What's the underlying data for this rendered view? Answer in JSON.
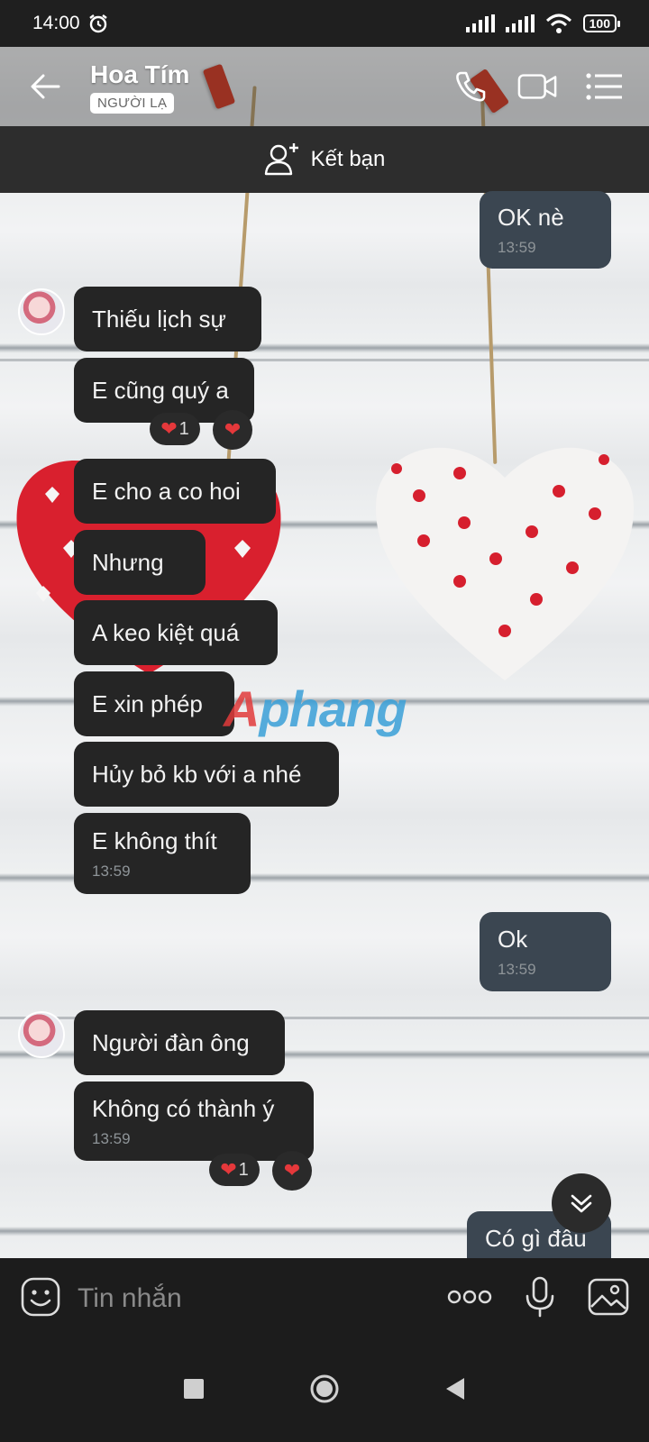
{
  "status_bar": {
    "time": "14:00",
    "battery": "100",
    "icons": [
      "alarm-icon",
      "signal-icon",
      "signal-icon",
      "wifi-icon",
      "battery-icon"
    ]
  },
  "header": {
    "contact_name": "Hoa Tím",
    "badge": "NGƯỜI LẠ",
    "icons": [
      "back-arrow-icon",
      "phone-icon",
      "video-call-icon",
      "menu-list-icon"
    ]
  },
  "add_friend": {
    "label": "Kết bạn",
    "icon": "add-user-icon"
  },
  "messages": [
    {
      "side": "sent",
      "text": "OK nè",
      "time": "13:59"
    },
    {
      "side": "received",
      "text": "Thiếu lịch sự"
    },
    {
      "side": "received",
      "text": "E cũng quý a",
      "reaction": {
        "emoji": "heart",
        "count": "1"
      }
    },
    {
      "side": "received",
      "text": "E cho a co hoi"
    },
    {
      "side": "received",
      "text": "Nhưng"
    },
    {
      "side": "received",
      "text": "A keo kiệt quá"
    },
    {
      "side": "received",
      "text": "E xin phép"
    },
    {
      "side": "received",
      "text": "Hủy bỏ kb với a nhé"
    },
    {
      "side": "received",
      "text": "E không thít",
      "time": "13:59"
    },
    {
      "side": "sent",
      "text": "Ok",
      "time": "13:59"
    },
    {
      "side": "received",
      "text": "Người đàn ông"
    },
    {
      "side": "received",
      "text": "Không có thành ý",
      "time": "13:59",
      "reaction": {
        "emoji": "heart",
        "count": "1"
      }
    },
    {
      "side": "sent",
      "text": "Có gì đâu"
    }
  ],
  "watermark": {
    "first": "A",
    "rest": "phang"
  },
  "input": {
    "placeholder": "Tin nhắn",
    "icons": [
      "sticker-icon",
      "more-options-icon",
      "microphone-icon",
      "image-icon"
    ]
  },
  "nav_bar": {
    "icons": [
      "recents-square-icon",
      "home-circle-icon",
      "back-triangle-icon"
    ]
  },
  "colors": {
    "received_bubble": "#252525",
    "sent_bubble": "#3b4651",
    "reaction_heart": "#e5383b"
  }
}
